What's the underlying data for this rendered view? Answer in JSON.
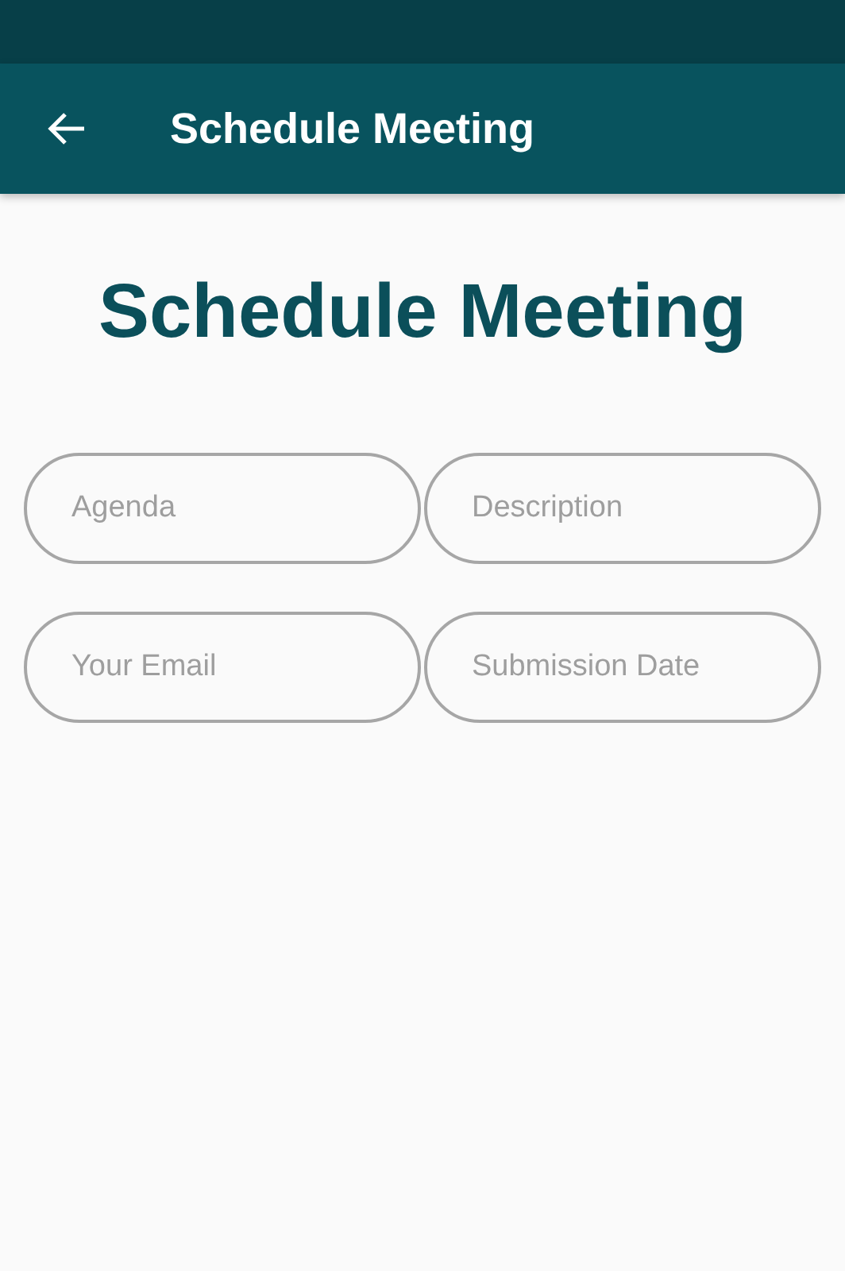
{
  "app_bar": {
    "title": "Schedule Meeting"
  },
  "heading": "Schedule Meeting",
  "fields": [
    {
      "placeholder": "Agenda"
    },
    {
      "placeholder": "Description"
    },
    {
      "placeholder": "Your Email"
    },
    {
      "placeholder": "Submission Date"
    }
  ]
}
